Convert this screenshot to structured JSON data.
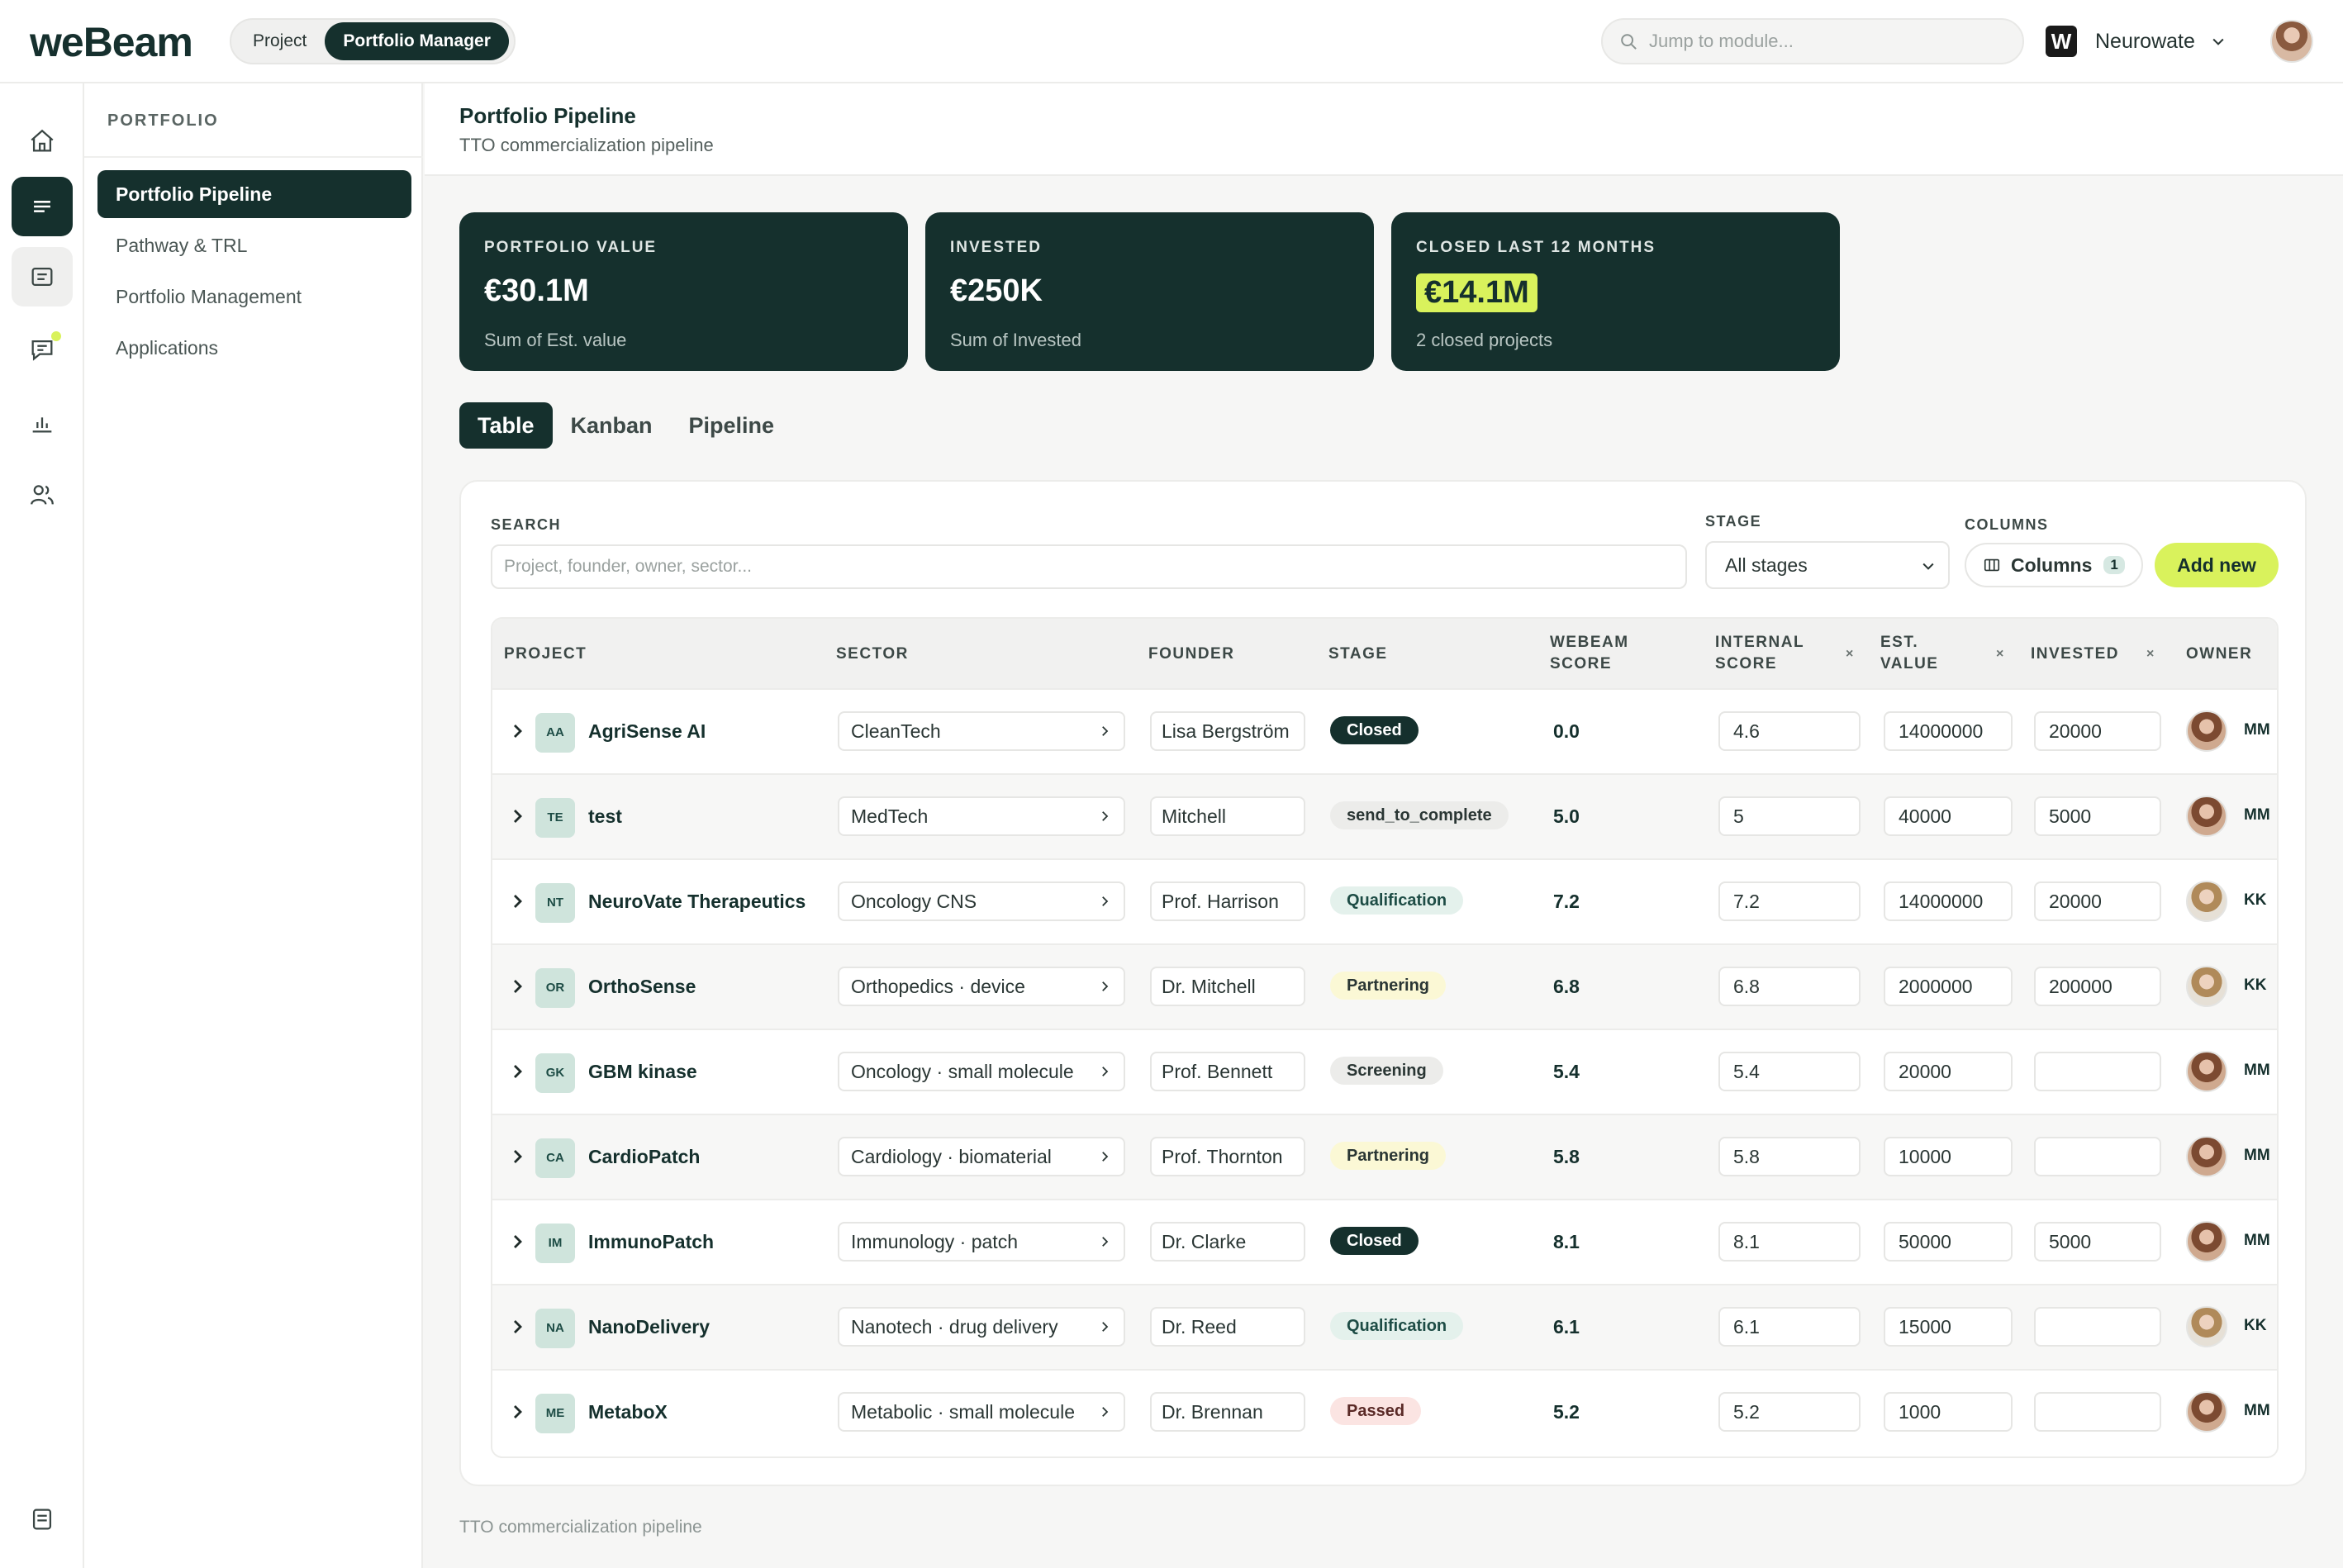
{
  "app": {
    "logo": "weBeam",
    "modes": [
      "Project",
      "Portfolio Manager"
    ],
    "active_mode": "Portfolio Manager",
    "jump_placeholder": "Jump to module...",
    "org_name": "Neurowate",
    "org_logo_letter": "W"
  },
  "subnav": {
    "section": "PORTFOLIO",
    "items": [
      "Portfolio Pipeline",
      "Pathway & TRL",
      "Portfolio Management",
      "Applications"
    ]
  },
  "page": {
    "title": "Portfolio Pipeline",
    "subtitle": "TTO commercialization pipeline",
    "footer": "TTO commercialization pipeline"
  },
  "kpis": [
    {
      "label": "PORTFOLIO VALUE",
      "value": "€30.1M",
      "caption": "Sum of Est. value"
    },
    {
      "label": "INVESTED",
      "value": "€250K",
      "caption": "Sum of Invested"
    },
    {
      "label": "CLOSED LAST 12 MONTHS",
      "value": "€14.1M",
      "caption": "2 closed projects"
    }
  ],
  "tabs": [
    "Table",
    "Kanban",
    "Pipeline"
  ],
  "filters": {
    "search_label": "SEARCH",
    "search_placeholder": "Project, founder, owner, sector...",
    "stage_label": "STAGE",
    "stage_value": "All stages",
    "columns_label": "COLUMNS",
    "columns_button": "Columns",
    "columns_count": "1",
    "add_new": "Add new"
  },
  "table": {
    "headers": {
      "project": "PROJECT",
      "sector": "SECTOR",
      "founder": "FOUNDER",
      "stage": "STAGE",
      "webeam1": "WEBEAM",
      "webeam2": "SCORE",
      "internal1": "INTERNAL",
      "internal2": "SCORE",
      "est1": "EST.",
      "est2": "VALUE",
      "invested": "INVESTED",
      "owner": "OWNER",
      "remove": "×"
    },
    "rows": [
      {
        "initials": "AA",
        "name": "AgriSense AI",
        "sector": "CleanTech",
        "founder": "Lisa Bergström",
        "stage": "Closed",
        "stage_style": "closed",
        "webeam": "0.0",
        "internal": "4.6",
        "est": "14000000",
        "invested": "20000",
        "owner": "MM"
      },
      {
        "initials": "TE",
        "name": "test",
        "sector": "MedTech",
        "founder": "Mitchell",
        "stage": "send_to_complete",
        "stage_style": "gray",
        "webeam": "5.0",
        "internal": "5",
        "est": "40000",
        "invested": "5000",
        "owner": "MM"
      },
      {
        "initials": "NT",
        "name": "NeuroVate Therapeutics",
        "sector": "Oncology CNS",
        "founder": "Prof. Harrison",
        "stage": "Qualification",
        "stage_style": "green",
        "webeam": "7.2",
        "internal": "7.2",
        "est": "14000000",
        "invested": "20000",
        "owner": "KK"
      },
      {
        "initials": "OR",
        "name": "OrthoSense",
        "sector": "Orthopedics · device",
        "founder": "Dr. Mitchell",
        "stage": "Partnering",
        "stage_style": "yellow",
        "webeam": "6.8",
        "internal": "6.8",
        "est": "2000000",
        "invested": "200000",
        "owner": "KK"
      },
      {
        "initials": "GK",
        "name": "GBM kinase",
        "sector": "Oncology · small molecule",
        "founder": "Prof. Bennett",
        "stage": "Screening",
        "stage_style": "gray",
        "webeam": "5.4",
        "internal": "5.4",
        "est": "20000",
        "invested": "",
        "owner": "MM"
      },
      {
        "initials": "CA",
        "name": "CardioPatch",
        "sector": "Cardiology · biomaterial",
        "founder": "Prof. Thornton",
        "stage": "Partnering",
        "stage_style": "yellow",
        "webeam": "5.8",
        "internal": "5.8",
        "est": "10000",
        "invested": "",
        "owner": "MM"
      },
      {
        "initials": "IM",
        "name": "ImmunoPatch",
        "sector": "Immunology · patch",
        "founder": "Dr. Clarke",
        "stage": "Closed",
        "stage_style": "closed",
        "webeam": "8.1",
        "internal": "8.1",
        "est": "50000",
        "invested": "5000",
        "owner": "MM"
      },
      {
        "initials": "NA",
        "name": "NanoDelivery",
        "sector": "Nanotech · drug delivery",
        "founder": "Dr. Reed",
        "stage": "Qualification",
        "stage_style": "green",
        "webeam": "6.1",
        "internal": "6.1",
        "est": "15000",
        "invested": "",
        "owner": "KK"
      },
      {
        "initials": "ME",
        "name": "MetaboX",
        "sector": "Metabolic · small molecule",
        "founder": "Dr. Brennan",
        "stage": "Passed",
        "stage_style": "red",
        "webeam": "5.2",
        "internal": "5.2",
        "est": "1000",
        "invested": "",
        "owner": "MM"
      }
    ]
  }
}
